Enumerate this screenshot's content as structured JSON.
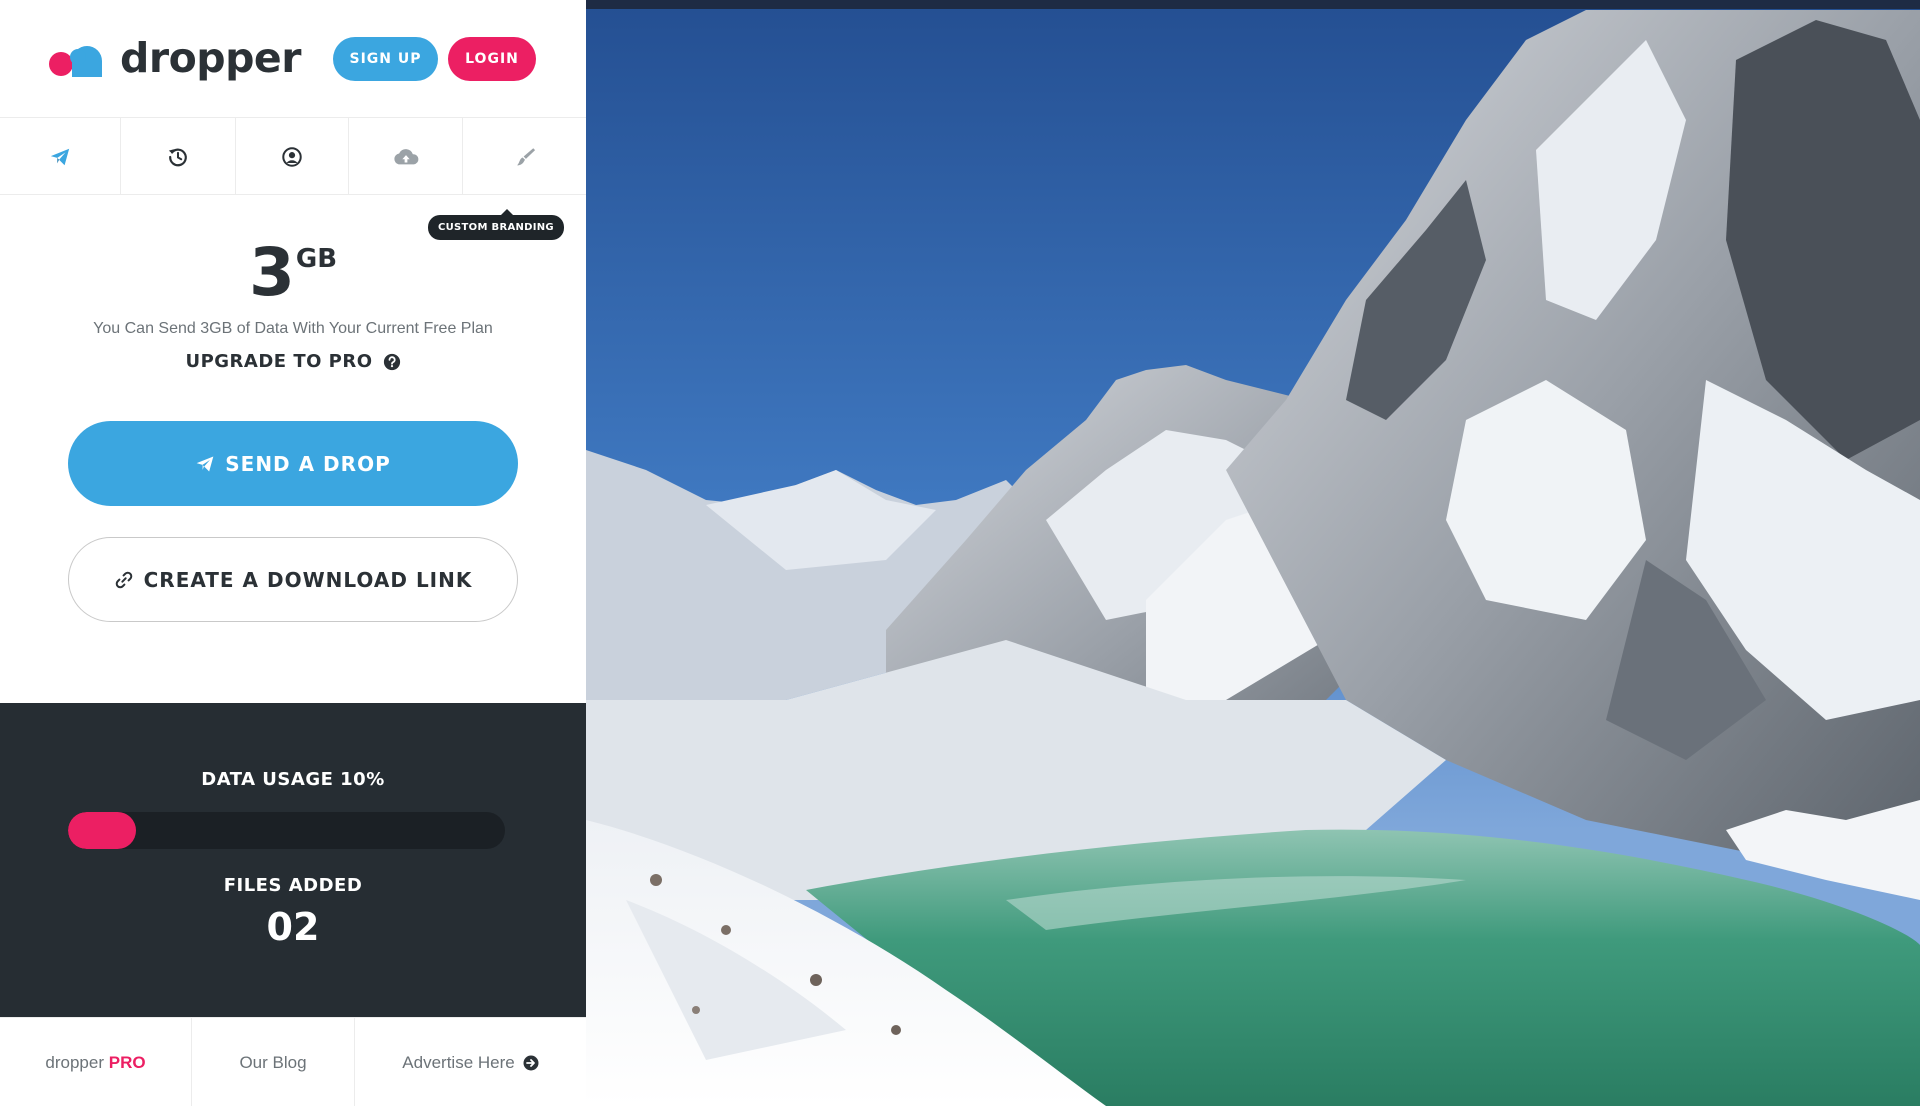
{
  "app": {
    "name": "dropper"
  },
  "header": {
    "signup_label": "SIGN UP",
    "login_label": "LOGIN"
  },
  "tabs": [
    {
      "icon": "paper-plane-icon"
    },
    {
      "icon": "history-icon"
    },
    {
      "icon": "user-circle-icon"
    },
    {
      "icon": "cloud-upload-icon"
    },
    {
      "icon": "paint-brush-icon"
    }
  ],
  "tooltip": {
    "text": "CUSTOM BRANDING"
  },
  "quota": {
    "amount": "3",
    "unit": "GB",
    "description": "You Can Send 3GB of Data With Your Current Free Plan",
    "upgrade_label": "UPGRADE TO PRO"
  },
  "actions": {
    "send_label": "SEND A DROP",
    "link_label": "CREATE A DOWNLOAD LINK"
  },
  "stats": {
    "usage_label": "DATA USAGE 10%",
    "usage_percent": 10,
    "files_label": "FILES ADDED",
    "files_count": "02"
  },
  "footer": {
    "pro_prefix": "dropper",
    "pro_accent": "PRO",
    "blog_label": "Our Blog",
    "advertise_label": "Advertise Here"
  },
  "colors": {
    "accent_blue": "#3ba6e0",
    "accent_pink": "#ec1f63",
    "dark_panel": "#262d33",
    "text_dark": "#2b3136"
  }
}
